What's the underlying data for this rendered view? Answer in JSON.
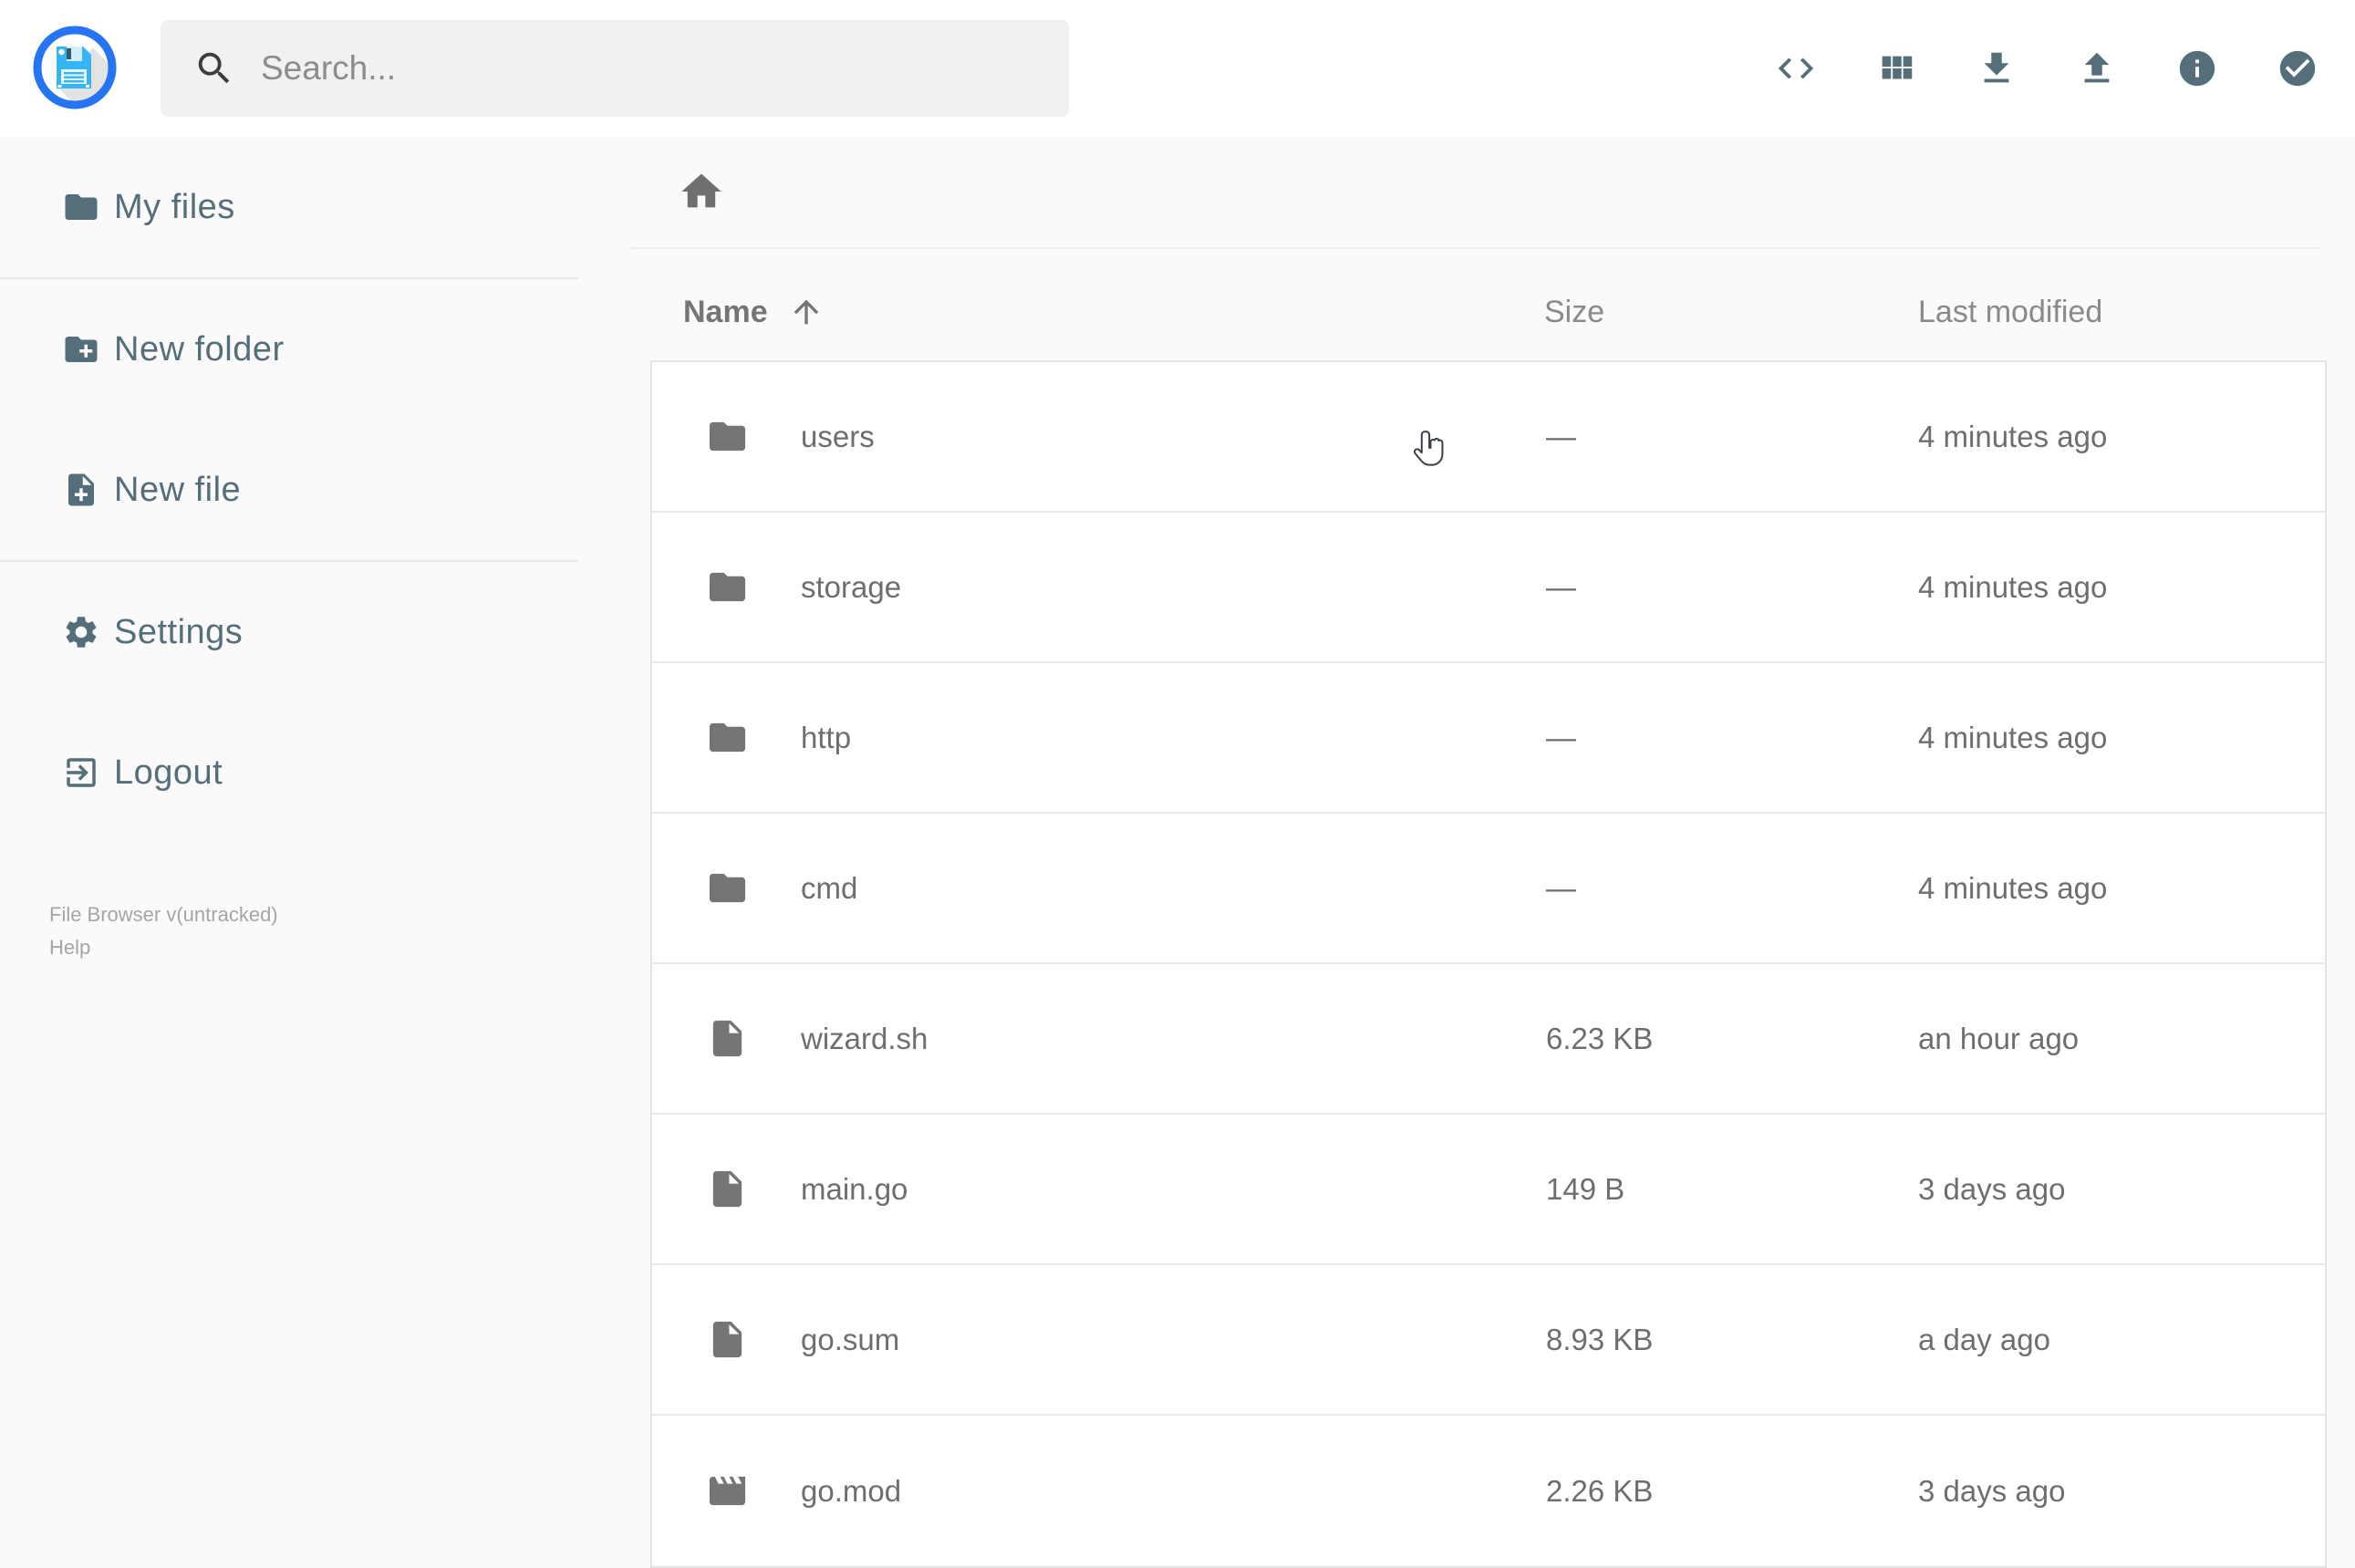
{
  "header": {
    "search": {
      "placeholder": "Search..."
    },
    "actions": [
      {
        "label": "shell",
        "icon": "code-icon"
      },
      {
        "label": "switch-view",
        "icon": "grid-icon"
      },
      {
        "label": "download",
        "icon": "download-icon"
      },
      {
        "label": "upload",
        "icon": "upload-icon"
      },
      {
        "label": "info",
        "icon": "info-icon"
      },
      {
        "label": "select-multiple",
        "icon": "check-circle-icon"
      }
    ]
  },
  "sidebar": {
    "items": [
      {
        "label": "My files",
        "icon": "folder-icon"
      },
      {
        "label": "New folder",
        "icon": "folder-plus-icon"
      },
      {
        "label": "New file",
        "icon": "file-plus-icon"
      },
      {
        "label": "Settings",
        "icon": "gear-icon"
      },
      {
        "label": "Logout",
        "icon": "logout-icon"
      }
    ],
    "footer": {
      "version": "File Browser v(untracked)",
      "help": "Help"
    }
  },
  "main": {
    "breadcrumb": {
      "home_icon": "home-icon"
    },
    "columns": {
      "name": "Name",
      "size": "Size",
      "modified": "Last modified"
    },
    "sort": {
      "column": "Name",
      "direction": "ascending"
    },
    "files": [
      {
        "name": "users",
        "type": "folder",
        "size": "—",
        "modified": "4 minutes ago"
      },
      {
        "name": "storage",
        "type": "folder",
        "size": "—",
        "modified": "4 minutes ago"
      },
      {
        "name": "http",
        "type": "folder",
        "size": "—",
        "modified": "4 minutes ago"
      },
      {
        "name": "cmd",
        "type": "folder",
        "size": "—",
        "modified": "4 minutes ago"
      },
      {
        "name": "wizard.sh",
        "type": "file",
        "size": "6.23 KB",
        "modified": "an hour ago"
      },
      {
        "name": "main.go",
        "type": "file",
        "size": "149 B",
        "modified": "3 days ago"
      },
      {
        "name": "go.sum",
        "type": "file",
        "size": "8.93 KB",
        "modified": "a day ago"
      },
      {
        "name": "go.mod",
        "type": "movie",
        "size": "2.26 KB",
        "modified": "3 days ago"
      }
    ]
  },
  "colors": {
    "accent_bluegrey": "#546e7a",
    "logo_blue": "#2574f4",
    "logo_floppy": "#35b5f5",
    "row_icon_grey": "#757575",
    "text_grey": "#6e6e6e",
    "background": "#fafafa"
  }
}
